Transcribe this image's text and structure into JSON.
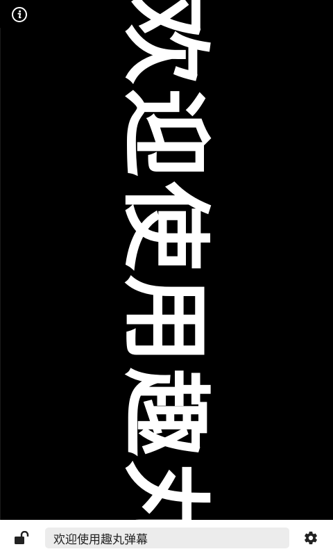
{
  "marquee": {
    "text": "欢迎使用趣丸"
  },
  "message_input": {
    "value": "欢迎使用趣丸弹幕",
    "placeholder": ""
  },
  "icons": {
    "info": "info-icon",
    "lock": "unlock-icon",
    "settings": "gear-icon"
  },
  "colors": {
    "background": "#000000",
    "text": "#ffffff",
    "bar": "#ffffff",
    "input_bg": "#ececec"
  }
}
